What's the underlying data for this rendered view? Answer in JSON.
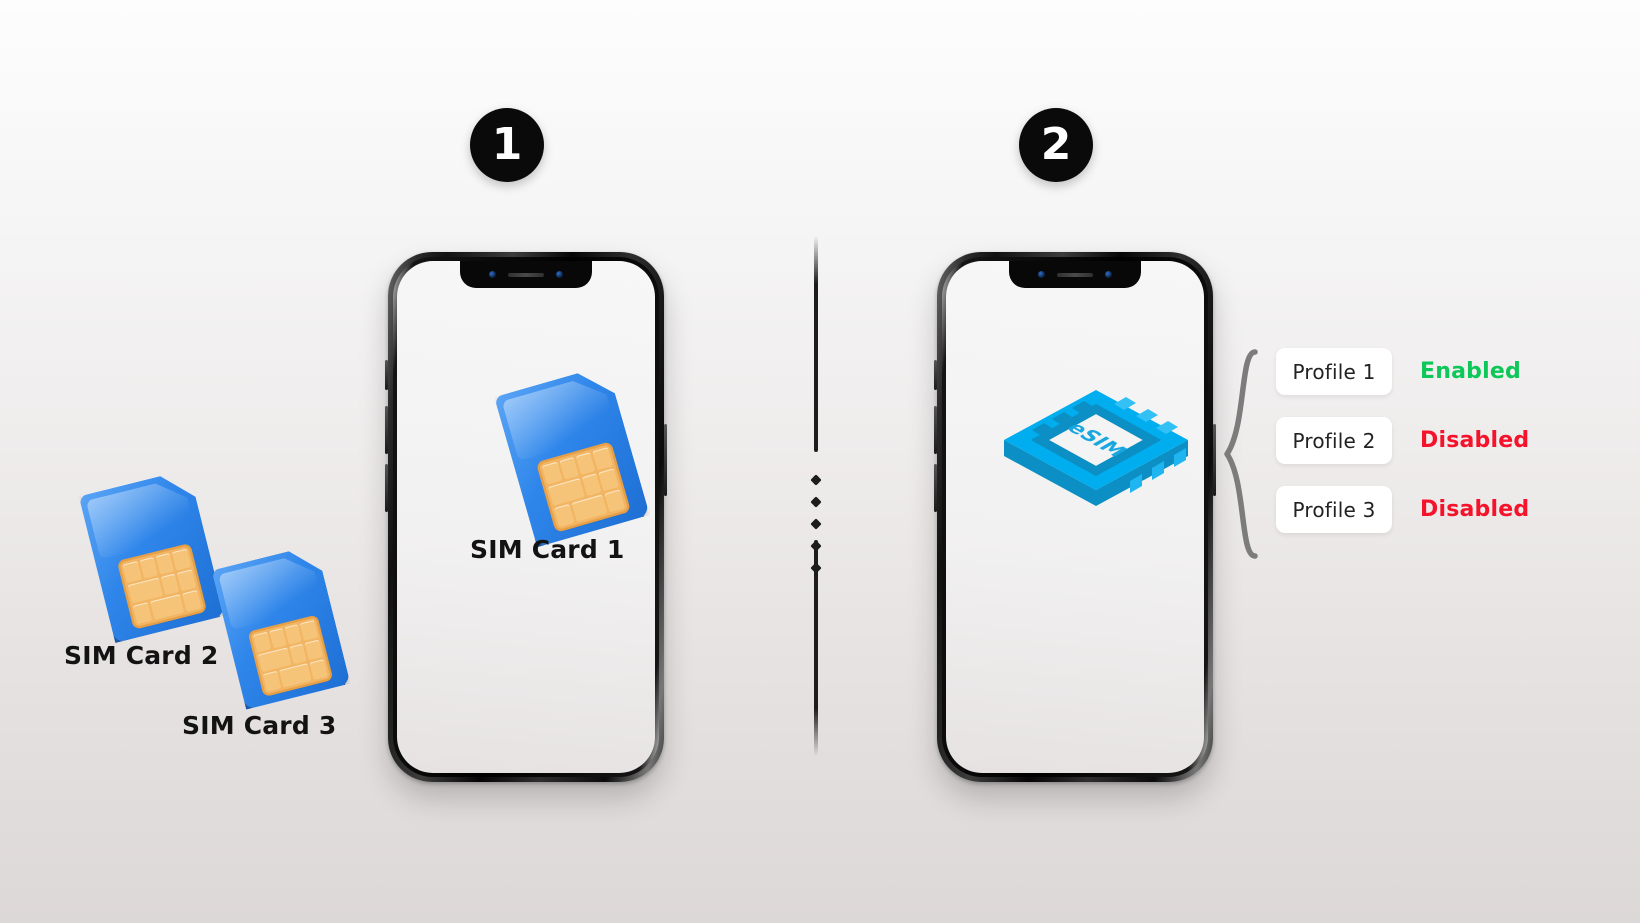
{
  "steps": [
    {
      "badge": "1"
    },
    {
      "badge": "2"
    }
  ],
  "physical_sim": {
    "cards": [
      {
        "id": "sim-card-1",
        "label": "SIM Card  1"
      },
      {
        "id": "sim-card-2",
        "label": "SIM Card  2"
      },
      {
        "id": "sim-card-3",
        "label": "SIM Card  3"
      }
    ]
  },
  "esim": {
    "chip_label": "eSIM",
    "chip_color": "#00aeef",
    "chip_dark": "#0b8fc4",
    "chip_text_color": "#1aa7e0",
    "profiles": [
      {
        "name": "Profile 1",
        "status": "Enabled",
        "status_color": "#0dc758"
      },
      {
        "name": "Profile 2",
        "status": "Disabled",
        "status_color": "#f5122b"
      },
      {
        "name": "Profile 3",
        "status": "Disabled",
        "status_color": "#f5122b"
      }
    ]
  },
  "divider": {
    "dot_count": 5
  },
  "icons": {
    "badge_one": "circled-number-one",
    "badge_two": "circled-number-two",
    "sim_card": "sim-card-icon",
    "esim_chip": "esim-chip-icon",
    "brace": "curly-brace-icon"
  },
  "theme": {
    "background_top": "#fdfdfd",
    "background_bottom": "#ddd8d8",
    "sim_blue": "#2f86ea",
    "sim_contact": "#f3bb6d",
    "brace_gray": "#7c7c7c"
  }
}
